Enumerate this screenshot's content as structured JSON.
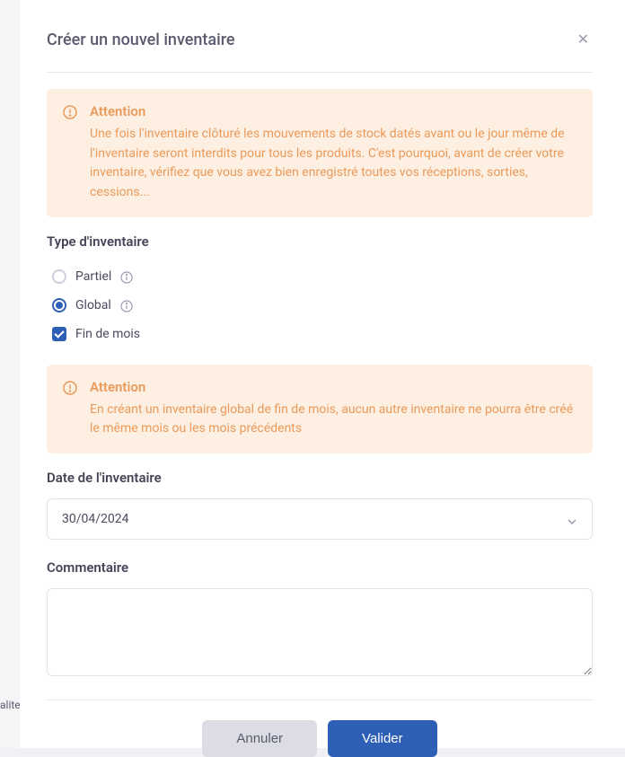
{
  "bg_text": "alite",
  "modal": {
    "title": "Créer un nouvel inventaire"
  },
  "alert1": {
    "title": "Attention",
    "text": "Une fois l'inventaire clôturé les mouvements de stock datés avant ou le jour même de l'inventaire seront interdits pour tous les produits. C'est pourquoi, avant de créer votre inventaire, vérifiez que vous avez bien enregistré toutes vos réceptions, sorties, cessions..."
  },
  "type_section": {
    "label": "Type d'inventaire",
    "options": {
      "partial": "Partiel",
      "global": "Global",
      "end_of_month": "Fin de mois"
    },
    "selected": "global",
    "end_of_month_checked": true
  },
  "alert2": {
    "title": "Attention",
    "text": "En créant un inventaire global de fin de mois, aucun autre inventaire ne pourra être créé le même mois ou les mois précédents"
  },
  "date_section": {
    "label": "Date de l'inventaire",
    "value": "30/04/2024"
  },
  "comment_section": {
    "label": "Commentaire",
    "value": ""
  },
  "footer": {
    "cancel": "Annuler",
    "submit": "Valider"
  }
}
